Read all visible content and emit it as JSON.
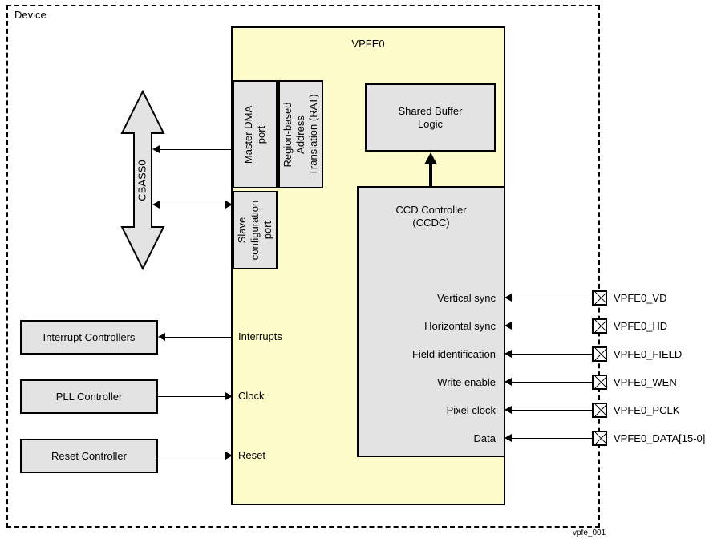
{
  "figure": {
    "id_caption": "vpfe_001",
    "device_label": "Device",
    "module_title": "VPFE0",
    "colors": {
      "module_fill": "#FFFCCC",
      "block_fill": "#E3E3E3",
      "stroke": "#000000",
      "background": "#FFFFFF"
    }
  },
  "interconnect": {
    "bus_label": "CBASS0"
  },
  "module_blocks": {
    "master_dma_port": "Master DMA\nport",
    "master_dma_port_line1": "Master DMA",
    "master_dma_port_line2": "port",
    "rat_line1": "Region-based",
    "rat_line2": "Address",
    "rat_line3": "Translation (RAT)",
    "slave_config_port_line1": "Slave",
    "slave_config_port_line2": "configuration",
    "slave_config_port_line3": "port",
    "shared_buffer_line1": "Shared Buffer",
    "shared_buffer_line2": "Logic",
    "ccdc_line1": "CCD Controller",
    "ccdc_line2": "(CCDC)"
  },
  "external_blocks": [
    {
      "id": "interrupt-controllers",
      "label": "Interrupt Controllers"
    },
    {
      "id": "pll-controller",
      "label": "PLL Controller"
    },
    {
      "id": "reset-controller",
      "label": "Reset Controller"
    }
  ],
  "module_ports": [
    {
      "id": "interrupts",
      "label": "Interrupts",
      "direction": "out"
    },
    {
      "id": "clock",
      "label": "Clock",
      "direction": "in"
    },
    {
      "id": "reset",
      "label": "Reset",
      "direction": "in"
    }
  ],
  "signals": [
    {
      "id": "vd",
      "function": "Vertical sync",
      "pin": "VPFE0_VD"
    },
    {
      "id": "hd",
      "function": "Horizontal sync",
      "pin": "VPFE0_HD"
    },
    {
      "id": "field",
      "function": "Field identification",
      "pin": "VPFE0_FIELD"
    },
    {
      "id": "wen",
      "function": "Write enable",
      "pin": "VPFE0_WEN"
    },
    {
      "id": "pclk",
      "function": "Pixel clock",
      "pin": "VPFE0_PCLK"
    },
    {
      "id": "data",
      "function": "Data",
      "pin": "VPFE0_DATA[15-0]"
    }
  ],
  "chart_data": {
    "type": "diagram",
    "title": "VPFE0",
    "nodes": [
      "Device",
      "CBASS0",
      "VPFE0",
      "Master DMA port",
      "Region-based Address Translation (RAT)",
      "Slave configuration port",
      "Shared Buffer Logic",
      "CCD Controller (CCDC)",
      "Interrupt Controllers",
      "PLL Controller",
      "Reset Controller"
    ],
    "edges": [
      {
        "from": "Master DMA port",
        "to": "CBASS0",
        "dir": "uni"
      },
      {
        "from": "CBASS0",
        "to": "Slave configuration port",
        "dir": "bi"
      },
      {
        "from": "CCD Controller (CCDC)",
        "to": "Shared Buffer Logic",
        "dir": "uni"
      },
      {
        "from": "VPFE0",
        "to": "Interrupt Controllers",
        "dir": "uni"
      },
      {
        "from": "PLL Controller",
        "to": "VPFE0",
        "dir": "uni"
      },
      {
        "from": "Reset Controller",
        "to": "VPFE0",
        "dir": "uni"
      },
      {
        "from": "VPFE0_VD",
        "to": "CCD Controller (CCDC)",
        "dir": "uni"
      },
      {
        "from": "VPFE0_HD",
        "to": "CCD Controller (CCDC)",
        "dir": "uni"
      },
      {
        "from": "VPFE0_FIELD",
        "to": "CCD Controller (CCDC)",
        "dir": "uni"
      },
      {
        "from": "VPFE0_WEN",
        "to": "CCD Controller (CCDC)",
        "dir": "uni"
      },
      {
        "from": "VPFE0_PCLK",
        "to": "CCD Controller (CCDC)",
        "dir": "uni"
      },
      {
        "from": "VPFE0_DATA[15-0]",
        "to": "CCD Controller (CCDC)",
        "dir": "uni"
      }
    ]
  }
}
